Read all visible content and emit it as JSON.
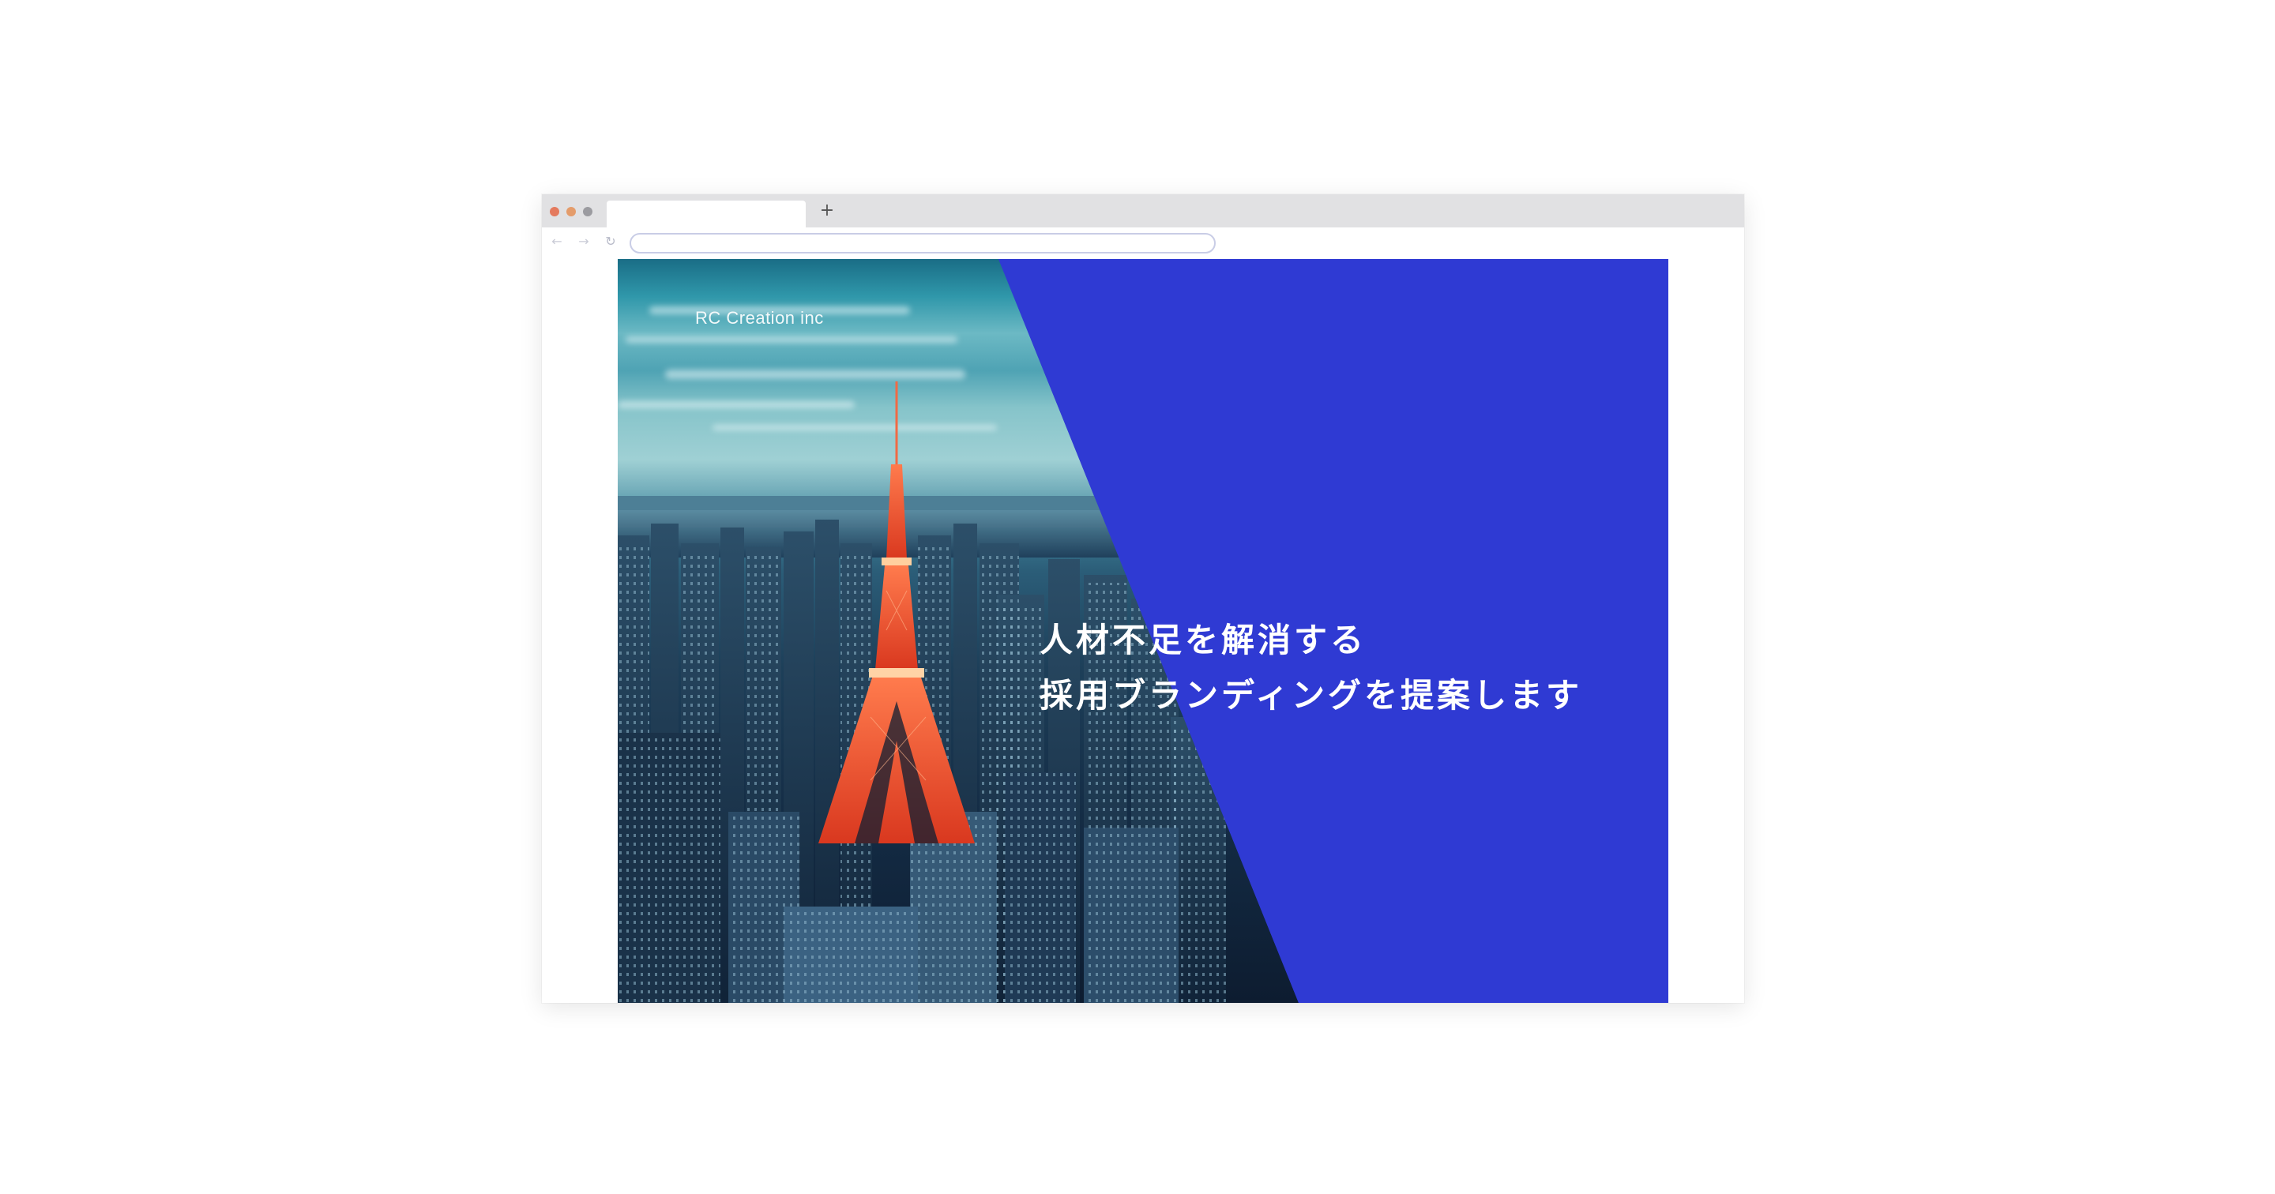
{
  "browser": {
    "tab_title": "",
    "new_tab_symbol": "+",
    "url": "",
    "nav": {
      "back_icon": "←",
      "forward_icon": "→",
      "reload_icon": "↻"
    },
    "window_controls": [
      "close",
      "minimize",
      "maximize"
    ]
  },
  "page": {
    "logo": "RC Creation inc",
    "headline_line1": "人材不足を解消する",
    "headline_line2": "採用ブランディングを提案します",
    "hero_image": "tokyo-tower-city-night-photo"
  },
  "colors": {
    "accent_blue": "#2f3ad3",
    "tower_red": "#e0452b",
    "tabbar_gray": "#e1e1e3",
    "close_dot": "#e47a5e",
    "minimize_dot": "#e49c6b",
    "maximize_dot": "#9b9ba0"
  }
}
